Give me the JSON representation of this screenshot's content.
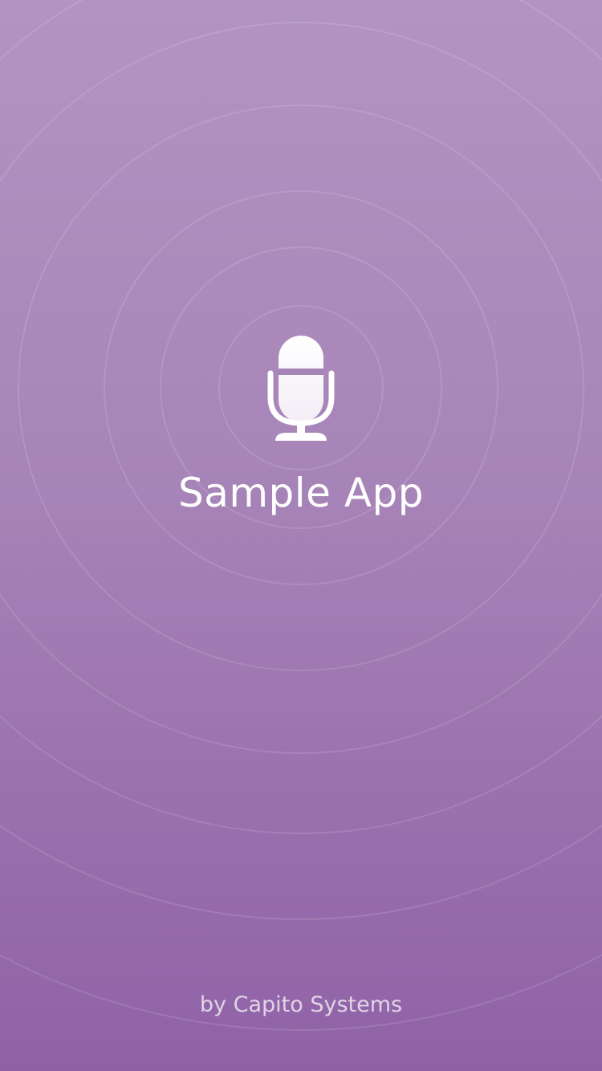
{
  "app": {
    "title": "Sample App",
    "credit": "by Capito Systems"
  },
  "icons": {
    "logo": "microphone-icon"
  },
  "colors": {
    "gradient_top": "#b394c1",
    "gradient_bottom": "#8f62a6",
    "text": "#ffffff",
    "ring_stroke": "#ffffff"
  }
}
